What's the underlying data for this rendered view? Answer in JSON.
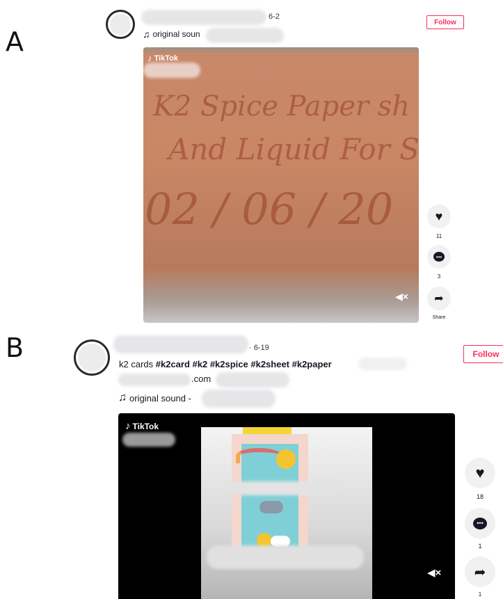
{
  "panel_a": {
    "letter": "A",
    "date": "6-2",
    "sound_label": "original soun",
    "follow_label": "Follow",
    "watermark": "TikTok",
    "handwriting": [
      "K2 Spice Paper sh",
      "And Liquid For S",
      "02 / 06 / 20"
    ],
    "actions": {
      "likes": "11",
      "comments": "3",
      "share": "Share"
    }
  },
  "panel_b": {
    "letter": "B",
    "date": "6-19",
    "caption": "k2 cards #k2card #k2 #k2spice #k2sheet #k2paper",
    "caption_plain": "k2 cards ",
    "hashtags": "#k2card #k2 #k2spice #k2sheet #k2paper",
    "link_suffix": ".com",
    "sound_label": "original sound -",
    "follow_label": "Follow",
    "watermark": "TikTok",
    "actions": {
      "likes": "18",
      "comments": "1",
      "shares": "1"
    }
  },
  "colors": {
    "accent": "#fe2c55",
    "black_video_bg": "#000000"
  },
  "icons": [
    "music-note-icon",
    "tiktok-logo-icon",
    "mute-icon",
    "heart-icon",
    "comment-icon",
    "share-icon"
  ]
}
